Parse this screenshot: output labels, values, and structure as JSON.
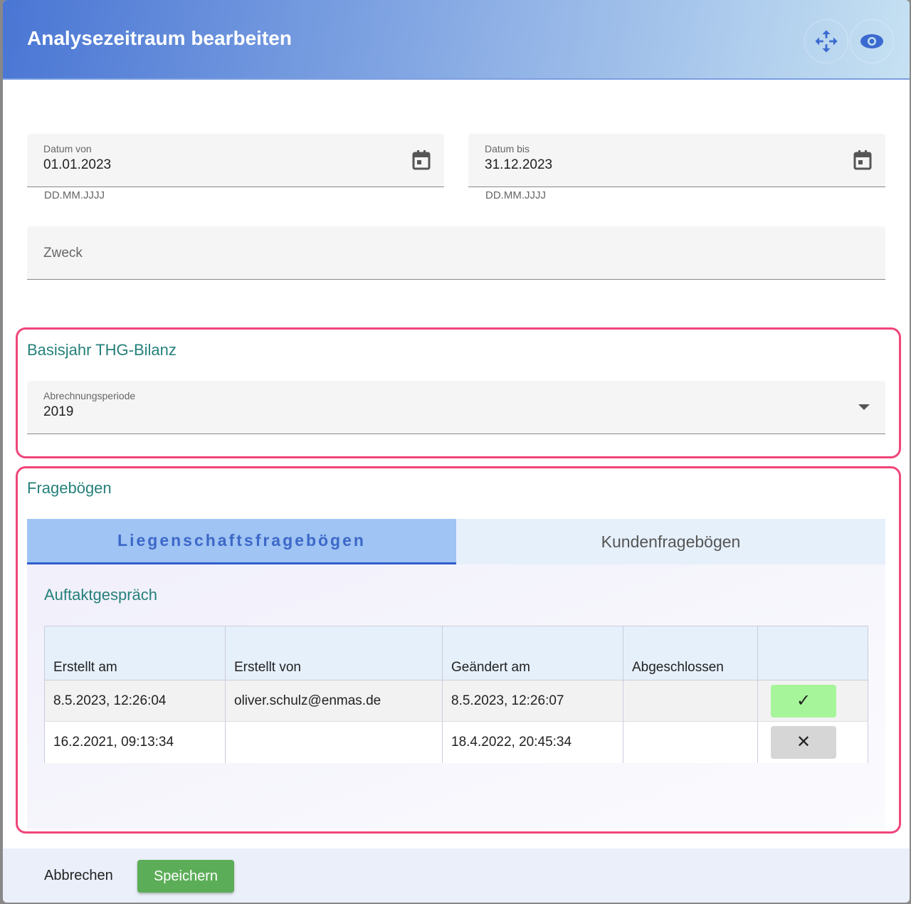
{
  "title": "Analysezeitraum bearbeiten",
  "header_icons": [
    "move-icon",
    "eye-icon"
  ],
  "datum_von": {
    "label": "Datum von",
    "value": "01.01.2023",
    "hint": "DD.MM.JJJJ"
  },
  "datum_bis": {
    "label": "Datum bis",
    "value": "31.12.2023",
    "hint": "DD.MM.JJJJ"
  },
  "zweck": {
    "placeholder": "Zweck"
  },
  "basisjahr": {
    "title": "Basisjahr THG-Bilanz",
    "label": "Abrechnungsperiode",
    "value": "2019"
  },
  "fragebogen": {
    "title": "Fragebögen",
    "tabs": [
      "Liegenschaftsfragebögen",
      "Kundenfragebögen"
    ],
    "active_tab": 0,
    "subtitle": "Auftaktgespräch",
    "columns": [
      "Erstellt am",
      "Erstellt von",
      "Geändert am",
      "Abgeschlossen",
      ""
    ],
    "rows": [
      {
        "erstellt_am": "8.5.2023, 12:26:04",
        "erstellt_von": "oliver.schulz@enmas.de",
        "geaendert_am": "8.5.2023, 12:26:07",
        "abgeschlossen": "",
        "status": "✓"
      },
      {
        "erstellt_am": "16.2.2021, 09:13:34",
        "erstellt_von": "",
        "geaendert_am": "18.4.2022, 20:45:34",
        "abgeschlossen": "",
        "status": "✕"
      }
    ]
  },
  "footer": {
    "cancel": "Abbrechen",
    "save": "Speichern"
  },
  "colors": {
    "accent": "#26807a",
    "highlight": "#f0457a",
    "save": "#5cad58"
  }
}
